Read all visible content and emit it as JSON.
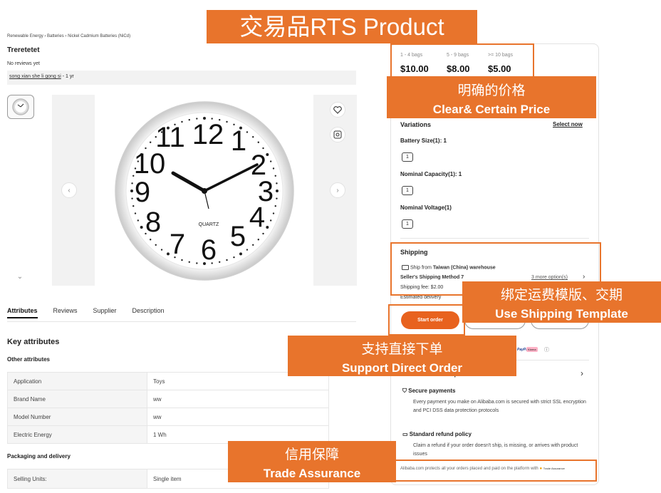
{
  "breadcrumb": [
    "Renewable Energy",
    "Batteries",
    "Nickel Cadmium Batteries (NiCd)"
  ],
  "product": {
    "title": "Treretetet",
    "reviews": "No reviews yet",
    "supplier": "song xian she li gong si",
    "supplier_years": " - 1 yr"
  },
  "tabs": [
    "Attributes",
    "Reviews",
    "Supplier",
    "Description"
  ],
  "key_attributes_title": "Key attributes",
  "other_attributes_title": "Other attributes",
  "attributes": [
    {
      "key": "Application",
      "value": "Toys"
    },
    {
      "key": "Brand Name",
      "value": "ww"
    },
    {
      "key": "Model Number",
      "value": "ww"
    },
    {
      "key": "Electric Energy",
      "value": "1 Wh"
    }
  ],
  "packaging_title": "Packaging and delivery",
  "packaging": [
    {
      "key": "Selling Units:",
      "value": "Single item"
    }
  ],
  "clock": {
    "brand": "QUARTZ"
  },
  "price_tiers": [
    {
      "range": "1 - 4 bags",
      "price": "$10.00"
    },
    {
      "range": "5 - 9 bags",
      "price": "$8.00"
    },
    {
      "range": ">= 10 bags",
      "price": "$5.00"
    }
  ],
  "variations": {
    "title": "Variations",
    "select_now": "Select now",
    "groups": [
      {
        "label": "Battery Size(1): 1",
        "option": "1"
      },
      {
        "label": "Nominal Capacity(1): 1",
        "option": "1"
      },
      {
        "label": "Nominal Voltage(1)",
        "option": "1"
      }
    ]
  },
  "shipping": {
    "title": "Shipping",
    "ship_from_prefix": "Ship from ",
    "ship_from_location": "Taiwan (China) warehouse",
    "method": "Seller's Shipping Method 7",
    "more_options": "3 more option(s)",
    "fee": "Shipping fee: $2.00",
    "estimated": "Estimated delivery"
  },
  "start_order": "Start order",
  "protection": {
    "title": "Protections for this product",
    "secure_title": "Secure payments",
    "secure_text": "Every payment you make on Alibaba.com is secured with strict SSL encryption and PCI DSS data protection protocols",
    "refund_title": "Standard refund policy",
    "refund_text": "Claim a refund if your order doesn't ship, is missing, or arrives with product issues",
    "assurance_text": "Alibaba.com protects all your orders placed and paid on the platform with",
    "assurance_brand": "Trade Assurance"
  },
  "payment_logos": [
    "PayPal",
    "Klarna"
  ],
  "annotations": {
    "main": "交易品RTS Product",
    "price_cn": "明确的价格",
    "price_en": "Clear& Certain Price",
    "shipping_cn": "绑定运费模版、交期",
    "shipping_en": "Use Shipping Template",
    "order_cn": "支持直接下单",
    "order_en": "Support Direct Order",
    "trade_cn": "信用保障",
    "trade_en": "Trade Assurance"
  },
  "colors": {
    "accent": "#e8742c",
    "button": "#e8621e"
  }
}
